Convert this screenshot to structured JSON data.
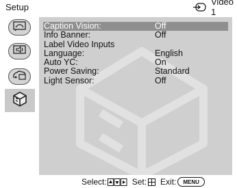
{
  "screen": {
    "title": "Setup",
    "input_label": "Video 1"
  },
  "sidebar": {
    "tabs": [
      {
        "name": "picture-icon",
        "active": false
      },
      {
        "name": "sound-icon",
        "active": false
      },
      {
        "name": "channel-icon",
        "active": false
      },
      {
        "name": "setup-icon",
        "active": true
      }
    ]
  },
  "menu": {
    "items": [
      {
        "label": "Caption Vision:",
        "value": "Off",
        "selected": true
      },
      {
        "label": "Info Banner:",
        "value": "Off",
        "selected": false
      },
      {
        "label": "Label Video Inputs",
        "value": "",
        "selected": false
      },
      {
        "label": "Language:",
        "value": "English",
        "selected": false
      },
      {
        "label": "Auto YC:",
        "value": "On",
        "selected": false
      },
      {
        "label": "Power Saving:",
        "value": "Standard",
        "selected": false
      },
      {
        "label": "Light Sensor:",
        "value": "Off",
        "selected": false
      }
    ]
  },
  "footer": {
    "select_label": "Select:",
    "set_label": "Set:",
    "exit_label": "Exit:",
    "menu_key": "MENU"
  },
  "colors": {
    "panel": "#cfcfcf",
    "highlight": "#8f8f8f",
    "tab": "#d4d4d4"
  }
}
